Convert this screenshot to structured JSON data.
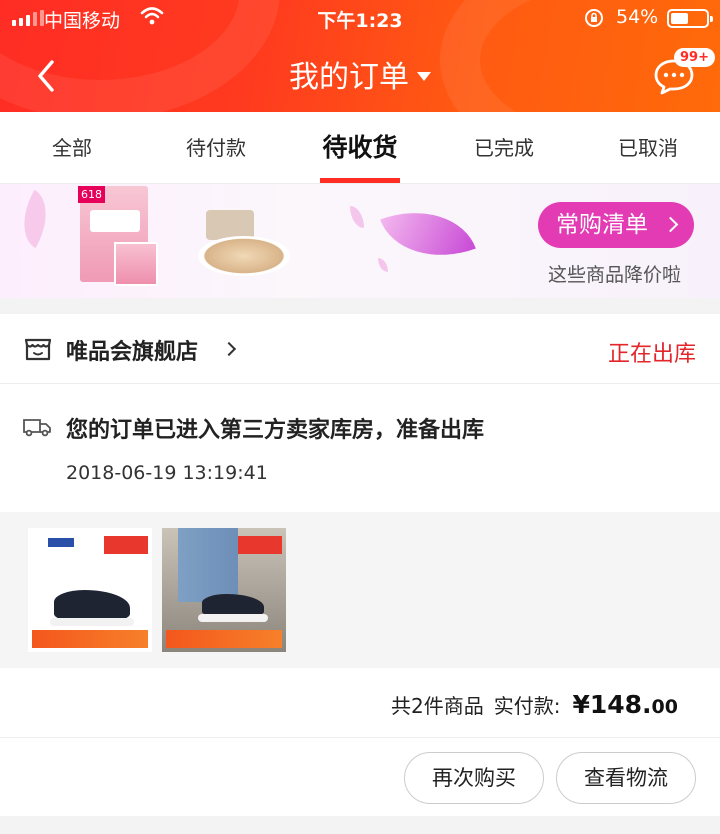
{
  "status_bar": {
    "carrier": "中国移动",
    "time": "下午1:23",
    "battery_percent": "54%",
    "battery_level": 0.54
  },
  "nav": {
    "title": "我的订单",
    "message_badge": "99+"
  },
  "tabs": [
    {
      "label": "全部",
      "active": false
    },
    {
      "label": "待付款",
      "active": false
    },
    {
      "label": "待收货",
      "active": true
    },
    {
      "label": "已完成",
      "active": false
    },
    {
      "label": "已取消",
      "active": false
    }
  ],
  "banner": {
    "button_label": "常购清单",
    "subtitle": "这些商品降价啦",
    "badge": "618"
  },
  "order": {
    "store_name": "唯品会旗舰店",
    "status": "正在出库",
    "shipping_message": "您的订单已进入第三方卖家库房，准备出库",
    "shipping_time": "2018-06-19 13:19:41",
    "item_count_text": "共2件商品",
    "paid_label": "实付款:",
    "amount_main": "¥148.",
    "amount_cents": "00",
    "actions": {
      "rebuy": "再次购买",
      "logistics": "查看物流"
    }
  },
  "colors": {
    "header_start": "#ff2d24",
    "header_end": "#ff6a0a",
    "accent_red": "#e3262b",
    "banner_button": "#e33bb4"
  }
}
